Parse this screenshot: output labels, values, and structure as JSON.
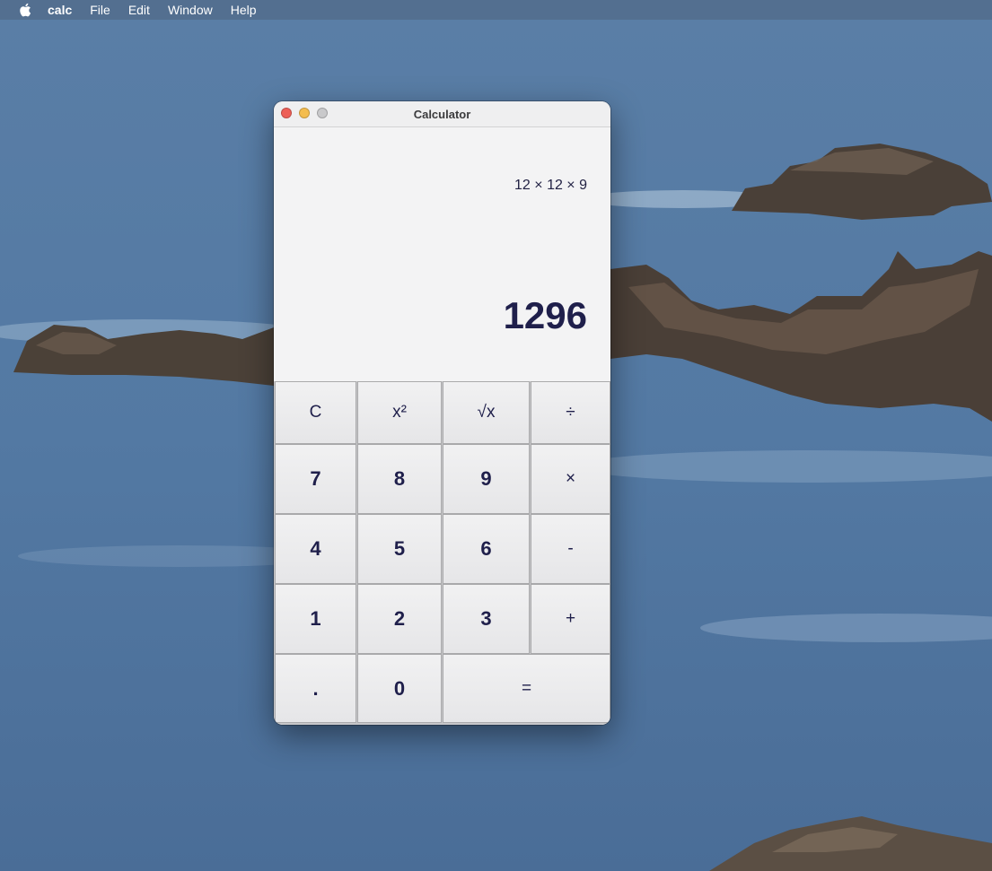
{
  "menubar": {
    "apple_icon": "apple-logo-icon",
    "app_name": "calc",
    "items": [
      "File",
      "Edit",
      "Window",
      "Help"
    ]
  },
  "window": {
    "title": "Calculator",
    "controls": [
      "close",
      "minimize",
      "zoom"
    ]
  },
  "display": {
    "expression": "12 × 12 × 9",
    "result": "1296"
  },
  "keypad": {
    "rows": [
      [
        "C",
        "x²",
        "√x",
        "÷"
      ],
      [
        "7",
        "8",
        "9",
        "×"
      ],
      [
        "4",
        "5",
        "6",
        "-"
      ],
      [
        "1",
        "2",
        "3",
        "+"
      ],
      [
        ".",
        "0",
        "="
      ]
    ]
  },
  "colors": {
    "text_accent": "#1f1f4b",
    "close": "#ed5f57",
    "minimize": "#f4bd4f",
    "zoom": "#c9c9cb"
  }
}
